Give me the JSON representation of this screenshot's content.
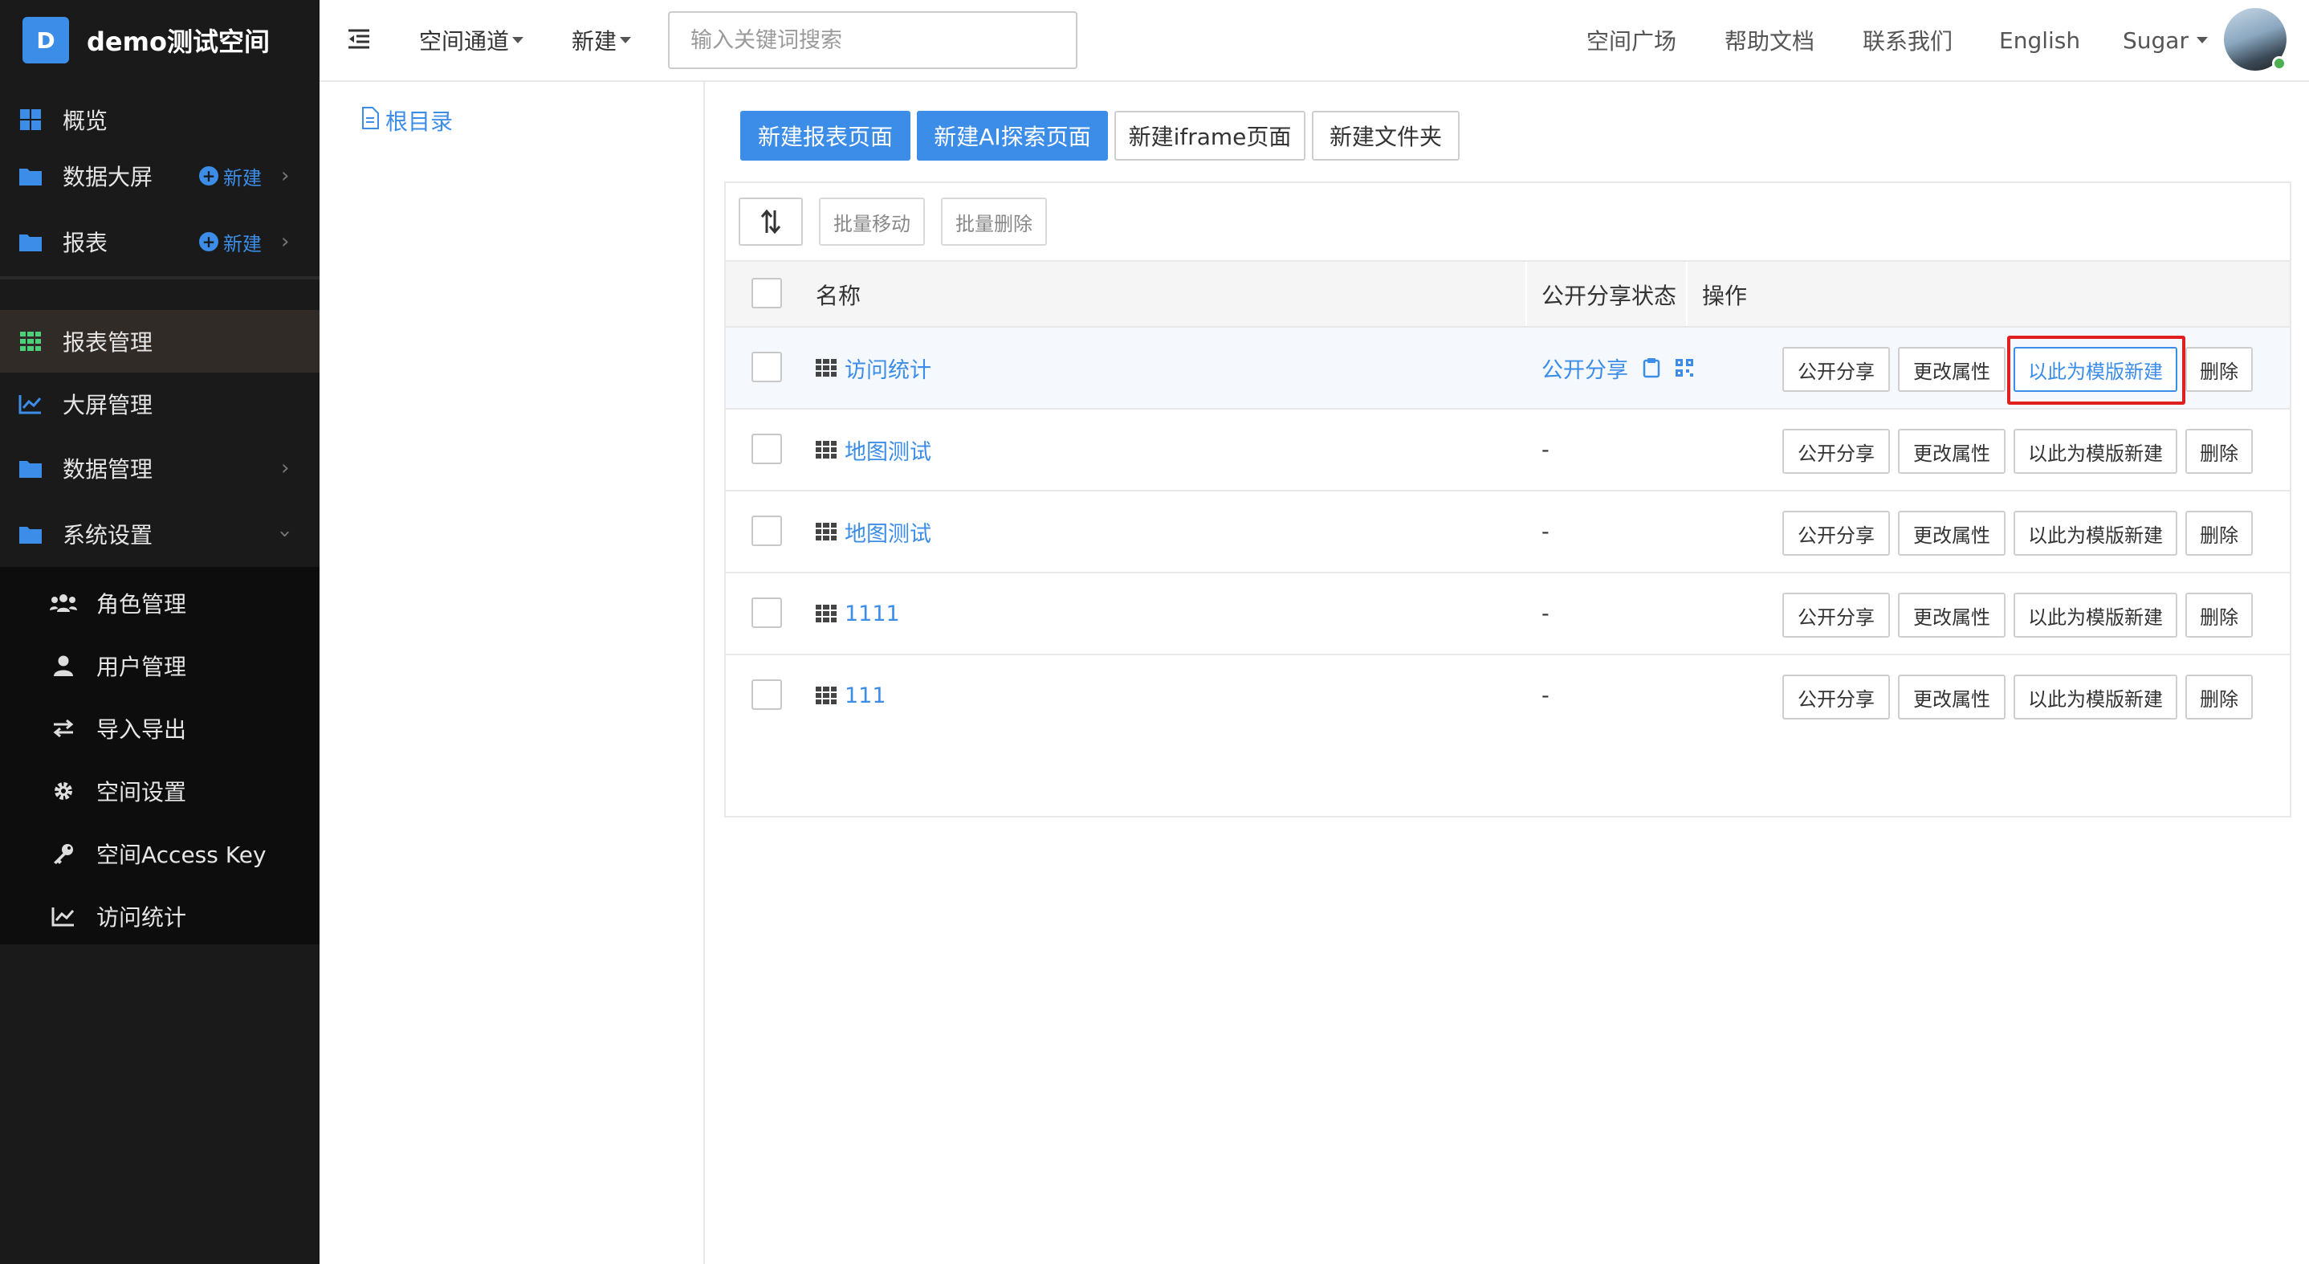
{
  "brand": {
    "badge": "D",
    "name": "demo测试空间"
  },
  "sidebar": {
    "items": [
      {
        "label": "概览"
      },
      {
        "label": "数据大屏",
        "new_label": "新建"
      },
      {
        "label": "报表",
        "new_label": "新建"
      },
      {
        "label": "报表管理"
      },
      {
        "label": "大屏管理"
      },
      {
        "label": "数据管理"
      },
      {
        "label": "系统设置"
      }
    ],
    "submenu": [
      {
        "label": "角色管理"
      },
      {
        "label": "用户管理"
      },
      {
        "label": "导入导出"
      },
      {
        "label": "空间设置"
      },
      {
        "label": "空间Access Key"
      },
      {
        "label": "访问统计"
      }
    ]
  },
  "header": {
    "space_channel": "空间通道",
    "new_menu": "新建",
    "search_placeholder": "输入关键词搜索",
    "links": {
      "plaza": "空间广场",
      "help": "帮助文档",
      "contact": "联系我们",
      "lang": "English"
    },
    "user": "Sugar"
  },
  "tree": {
    "root": "根目录"
  },
  "toolbar": {
    "new_report": "新建报表页面",
    "new_ai": "新建AI探索页面",
    "new_iframe": "新建iframe页面",
    "new_folder": "新建文件夹",
    "batch_move": "批量移动",
    "batch_delete": "批量删除"
  },
  "table": {
    "headers": {
      "name": "名称",
      "share_status": "公开分享状态",
      "actions": "操作"
    },
    "action_labels": {
      "share": "公开分享",
      "props": "更改属性",
      "template": "以此为模版新建",
      "delete": "删除"
    },
    "rows": [
      {
        "name": "访问统计",
        "share": "公开分享"
      },
      {
        "name": "地图测试",
        "share": "-"
      },
      {
        "name": "地图测试",
        "share": "-"
      },
      {
        "name": "1111",
        "share": "-"
      },
      {
        "name": "111",
        "share": "-"
      }
    ]
  },
  "colors": {
    "accent": "#3c8de8",
    "sidebar_bg": "#1a1a1a",
    "highlight_frame": "#e02020"
  }
}
